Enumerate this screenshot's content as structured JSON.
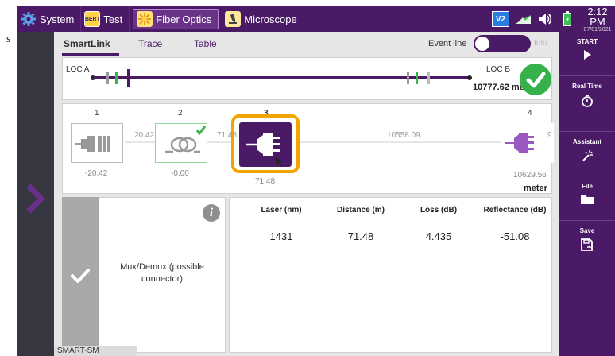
{
  "top_bar": {
    "tabs": [
      {
        "label": "System",
        "icon": "gear-icon"
      },
      {
        "label": "Test",
        "icon": "bert-icon",
        "icon_text": "BERT"
      },
      {
        "label": "Fiber Optics",
        "icon": "fiber-icon",
        "active": true
      },
      {
        "label": "Microscope",
        "icon": "microscope-icon"
      }
    ],
    "status_icons": [
      "vnc-icon",
      "network-icon",
      "volume-icon",
      "battery-icon"
    ],
    "vnc_text": "V2",
    "time": "2:12 PM",
    "date": "07/01/2021"
  },
  "sidebar": {
    "start": "START",
    "real_time": "Real Time",
    "assistant": "Assistant",
    "file": "File",
    "save": "Save"
  },
  "tabs": {
    "smartlink": "SmartLink",
    "trace": "Trace",
    "table": "Table",
    "event_line": "Event line",
    "info": "Info"
  },
  "link": {
    "loc_a": "LOC A",
    "loc_b": "LOC B",
    "distance": "10777.62 meter",
    "status": "pass"
  },
  "events": {
    "nums": [
      "1",
      "2",
      "3",
      "4"
    ],
    "below": [
      "-20.42",
      "-0.00",
      "71.48",
      "10629.56"
    ],
    "spans": [
      "20.42",
      "71.48",
      "10558.09",
      "9"
    ],
    "unit": "meter",
    "selected": "3"
  },
  "details": {
    "description": "Mux/Demux (possible connector)",
    "columns": [
      "Laser (nm)",
      "Distance (m)",
      "Loss  (dB)",
      "Reflectance (dB)"
    ],
    "values": [
      "1431",
      "71.48",
      "4.435",
      "-51.08"
    ]
  },
  "footer": {
    "tag": "SMART-SM"
  },
  "colors": {
    "brand_purple": "#4a1a66",
    "pass_green": "#35b04a",
    "selection_orange": "#f2a400"
  }
}
